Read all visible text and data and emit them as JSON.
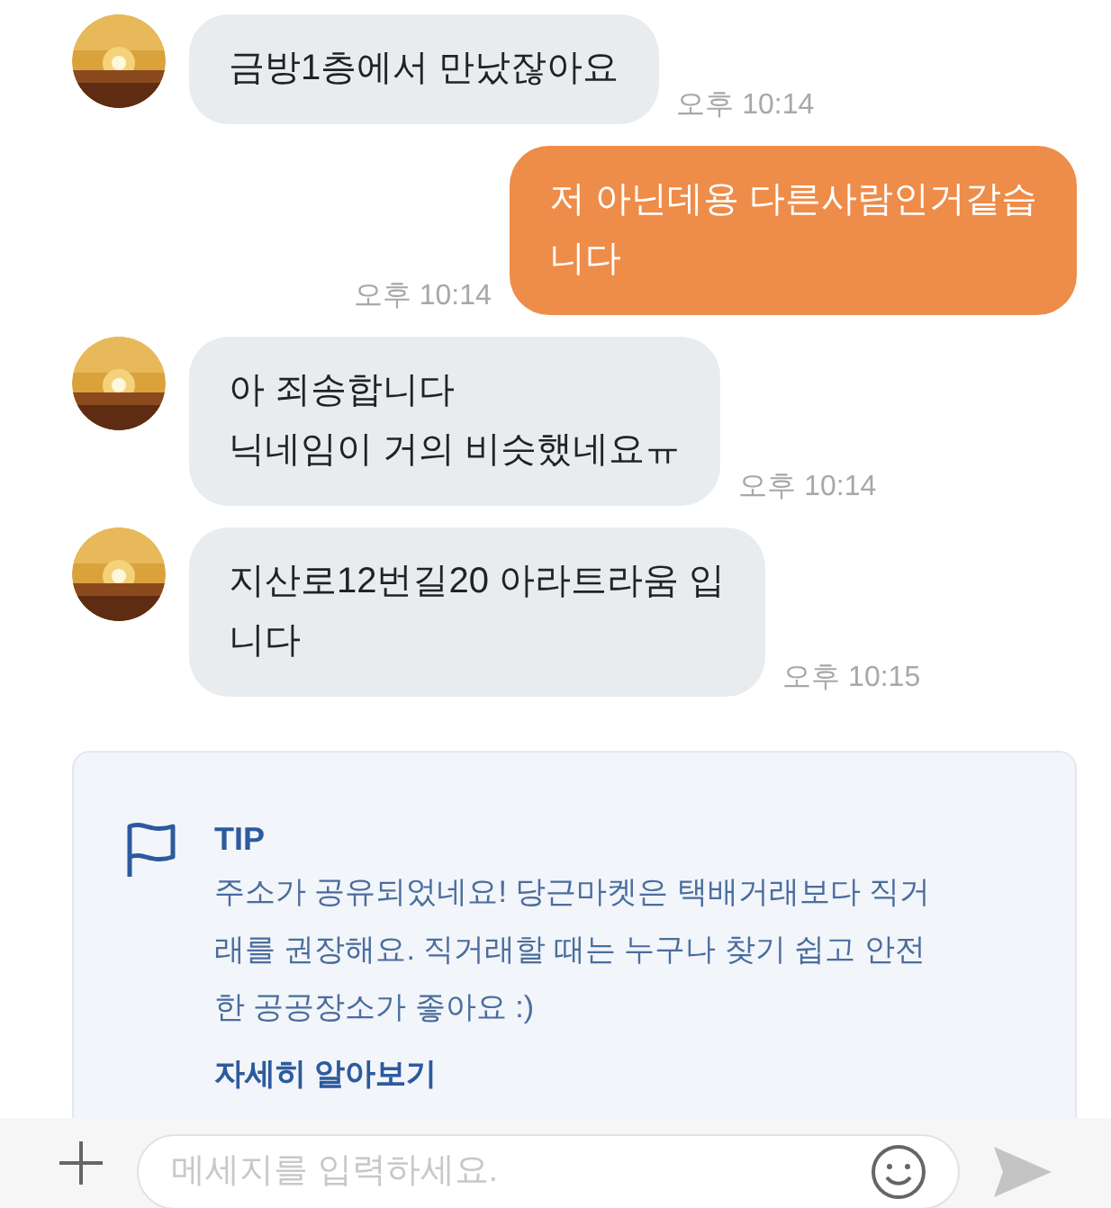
{
  "messages": [
    {
      "kind": "received",
      "lines": [
        "금방1층에서 만났잖아요"
      ],
      "time": "오후 10:14"
    },
    {
      "kind": "sent",
      "lines": [
        "저 아닌데용 다른사람인거같습",
        "니다"
      ],
      "time": "오후 10:14"
    },
    {
      "kind": "received",
      "lines": [
        "아 죄송합니다",
        "닉네임이 거의 비슷했네요ㅠ"
      ],
      "time": "오후 10:14"
    },
    {
      "kind": "received",
      "lines": [
        "지산로12번길20 아라트라움 입",
        "니다"
      ],
      "time": "오후 10:15"
    }
  ],
  "tip": {
    "title": "TIP",
    "lines": [
      "주소가 공유되었네요! 당근마켓은 택배거래보다 직거",
      "래를 권장해요. 직거래할 때는 누구나 찾기 쉽고 안전",
      "한 공공장소가 좋아요 :)"
    ],
    "link": "자세히 알아보기"
  },
  "composer": {
    "placeholder": "메세지를 입력하세요."
  }
}
